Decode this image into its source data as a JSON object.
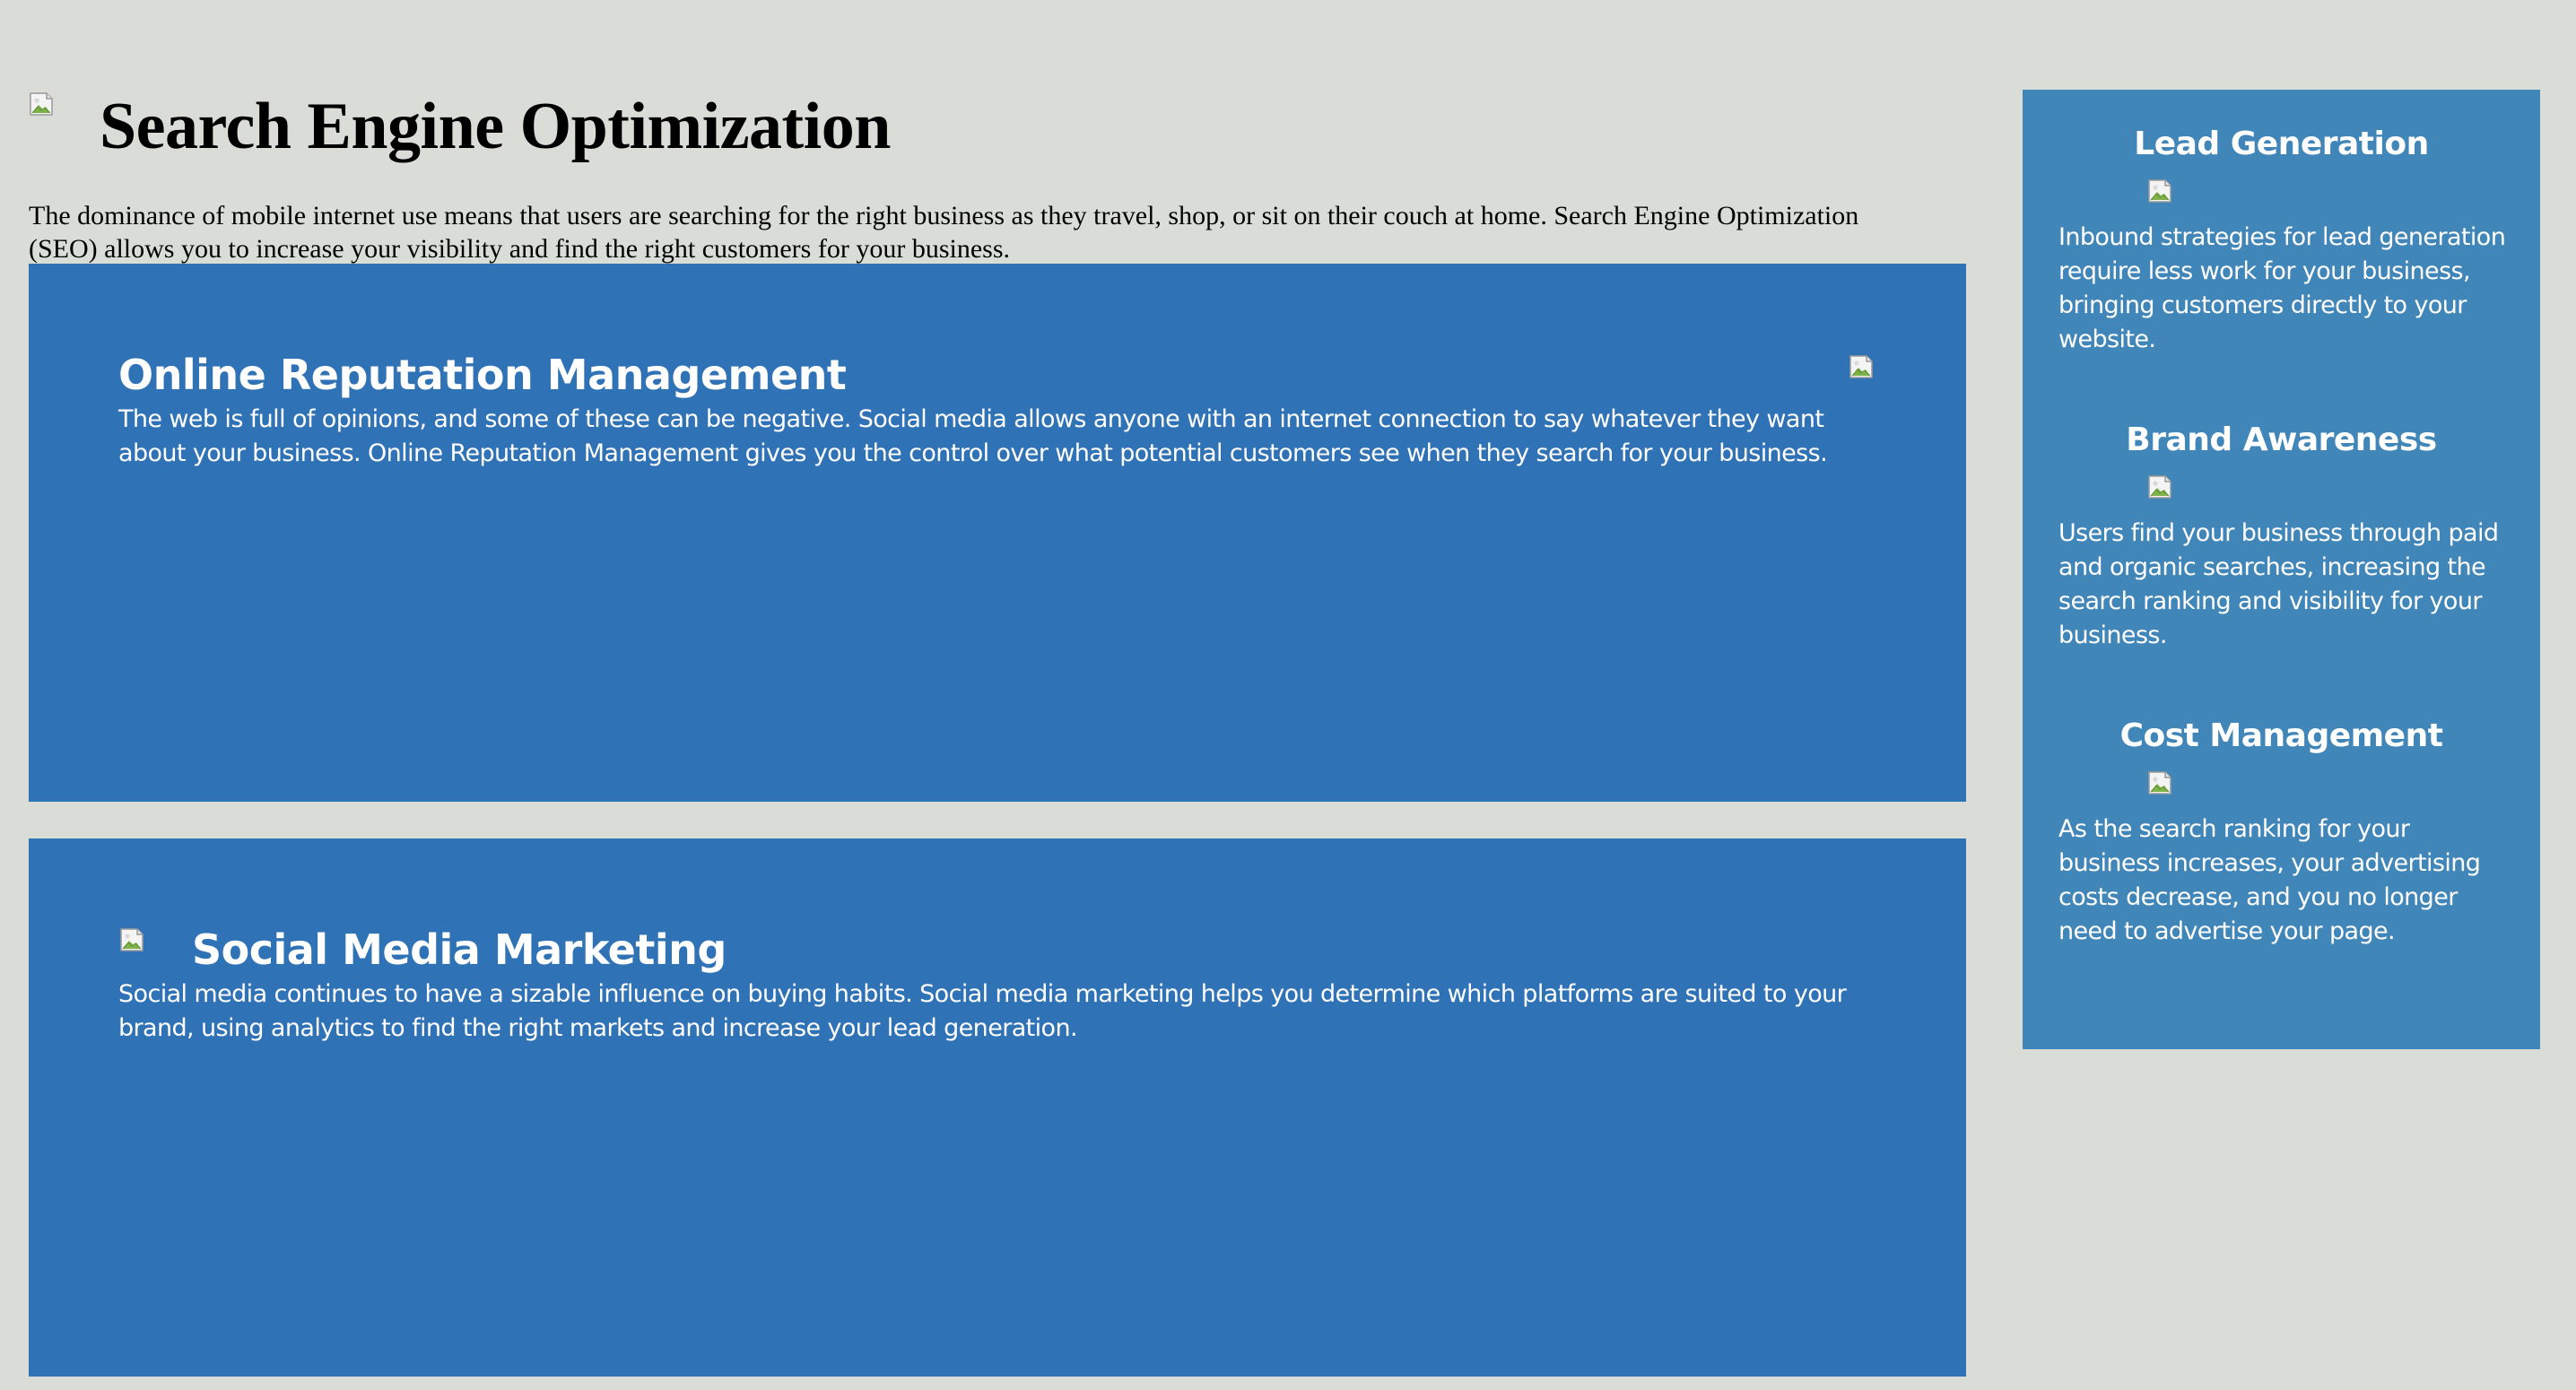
{
  "page": {
    "title": "Search Engine Optimization",
    "intro": "The dominance of mobile internet use means that users are searching for the right business as they travel, shop, or sit on their couch at home. Search Engine Optimization (SEO) allows you to increase your visibility and find the right customers for your business.",
    "header_icon": "broken-image-icon"
  },
  "colors": {
    "background": "#dadcd7",
    "panel": "#2f72b6",
    "sidebar": "#4186b8",
    "text_dark": "#000000",
    "text_light": "#ffffff"
  },
  "panels": [
    {
      "title": "Online Reputation Management",
      "text": "The web is full of opinions, and some of these can be negative. Social media allows anyone with an internet connection to say whatever they want about your business. Online Reputation Management gives you the control over what potential customers see when they search for your business.",
      "icon": "broken-image-icon"
    },
    {
      "title": "Social Media Marketing",
      "text": "Social media continues to have a sizable influence on buying habits. Social media marketing helps you determine which platforms are suited to your brand, using analytics to find the right markets and increase your lead generation.",
      "icon": "broken-image-icon"
    }
  ],
  "sidebar": {
    "items": [
      {
        "title": "Lead Generation",
        "text": "Inbound strategies for lead generation require less work for your business, bringing customers directly to your website.",
        "icon": "broken-image-icon"
      },
      {
        "title": "Brand Awareness",
        "text": "Users find your business through paid and organic searches, increasing the search ranking and visibility for your business.",
        "icon": "broken-image-icon"
      },
      {
        "title": "Cost Management",
        "text": "As the search ranking for your business increases, your advertising costs decrease, and you no longer need to advertise your page.",
        "icon": "broken-image-icon"
      }
    ]
  }
}
